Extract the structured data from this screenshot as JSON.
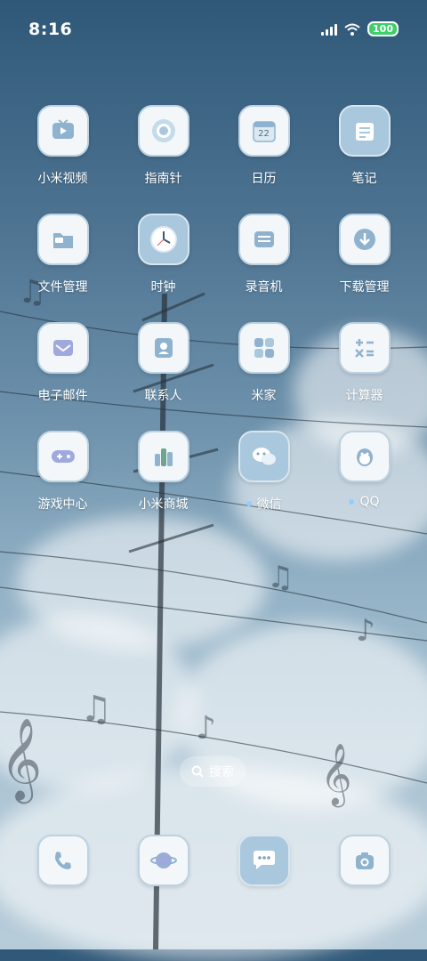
{
  "status_bar": {
    "time": "8:16",
    "battery": "100"
  },
  "apps": [
    {
      "label": "小米视频",
      "icon": "video-tv-icon"
    },
    {
      "label": "指南针",
      "icon": "compass-icon"
    },
    {
      "label": "日历",
      "icon": "calendar-icon",
      "day": "22"
    },
    {
      "label": "笔记",
      "icon": "notes-icon"
    },
    {
      "label": "文件管理",
      "icon": "folder-icon"
    },
    {
      "label": "时钟",
      "icon": "clock-icon"
    },
    {
      "label": "录音机",
      "icon": "recorder-icon"
    },
    {
      "label": "下载管理",
      "icon": "download-icon"
    },
    {
      "label": "电子邮件",
      "icon": "email-icon"
    },
    {
      "label": "联系人",
      "icon": "contacts-icon"
    },
    {
      "label": "米家",
      "icon": "mijia-icon"
    },
    {
      "label": "计算器",
      "icon": "calculator-icon"
    },
    {
      "label": "游戏中心",
      "icon": "gamepad-icon"
    },
    {
      "label": "小米商城",
      "icon": "mi-store-icon"
    },
    {
      "label": "微信",
      "icon": "wechat-icon",
      "new_badge": true
    },
    {
      "label": "QQ",
      "icon": "qq-icon",
      "new_badge": true
    }
  ],
  "search": {
    "label": "搜索"
  },
  "dock": [
    {
      "icon": "phone-icon"
    },
    {
      "icon": "browser-planet-icon"
    },
    {
      "icon": "messages-icon"
    },
    {
      "icon": "camera-icon"
    }
  ]
}
